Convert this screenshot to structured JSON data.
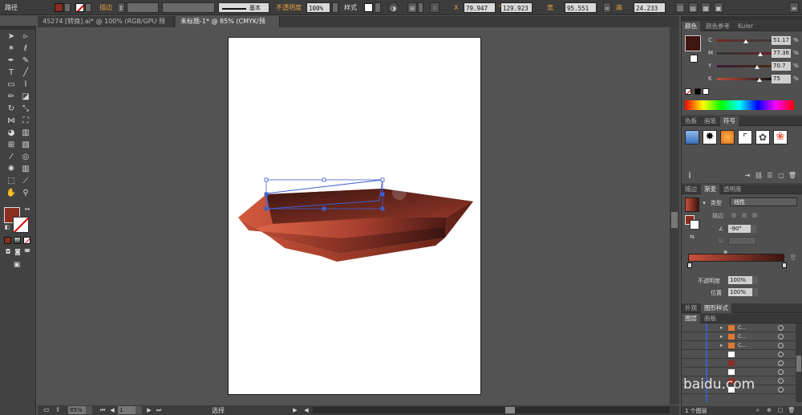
{
  "control_bar": {
    "selection_label": "路径",
    "stroke_label": "描边",
    "stroke_value": "",
    "stroke_profile": "基本",
    "opacity_label": "不透明度",
    "opacity_value": "100%",
    "style_label": "样式",
    "x_label": "X",
    "x_value": "79.947",
    "y_label": "Y",
    "y_value": "129.923",
    "w_label": "宽",
    "w_value": "95.551",
    "h_label": "高",
    "h_value": "24.233"
  },
  "tabs": [
    {
      "label": "45274 [转换].ai* @ 100% (RGB/GPU 预览)",
      "close": "×"
    },
    {
      "label": "未标题-1* @ 85% (CMYK/预览)",
      "close": "×"
    }
  ],
  "status_bar": {
    "zoom": "85%",
    "page": "1",
    "tool_name": "选择"
  },
  "color_panel": {
    "tabs": [
      "颜色",
      "颜色参考",
      "Kuler"
    ],
    "sliders": [
      {
        "letter": "C",
        "value": "51.17",
        "unit": "%",
        "fraction": 0.51
      },
      {
        "letter": "M",
        "value": "77.36",
        "unit": "%",
        "fraction": 0.77
      },
      {
        "letter": "Y",
        "value": "70.7",
        "unit": "%",
        "fraction": 0.71
      },
      {
        "letter": "K",
        "value": "75",
        "unit": "%",
        "fraction": 0.75
      }
    ],
    "swatch_color": "#3e1512"
  },
  "symbols_panel": {
    "tabs": [
      "色板",
      "画笔",
      "符号"
    ]
  },
  "gradient_panel": {
    "tabs": [
      "描边",
      "渐变",
      "透明度"
    ],
    "type_label": "类型",
    "type_value": "线性",
    "stroke_label": "描边",
    "angle_value": "-90°",
    "opacity_label": "不透明度",
    "opacity_value": "100%",
    "position_label": "位置",
    "position_value": "100%",
    "start_color": "#c8503a",
    "end_color": "#3c1510"
  },
  "appearance_panel": {
    "tabs": [
      "外观",
      "图形样式"
    ]
  },
  "layers_panel": {
    "tabs": [
      "图层",
      "画板"
    ],
    "rows": [
      "C...",
      "C...",
      "C...",
      "",
      "",
      "",
      "",
      ""
    ],
    "footer": "1 个图层"
  },
  "watermark": {
    "text": "baidu.com"
  },
  "colors": {
    "accent_orange": "#e8a046",
    "selection_blue": "#3f5fd0",
    "bowl_light": "#d45a3e",
    "bowl_dark": "#3a1410"
  }
}
